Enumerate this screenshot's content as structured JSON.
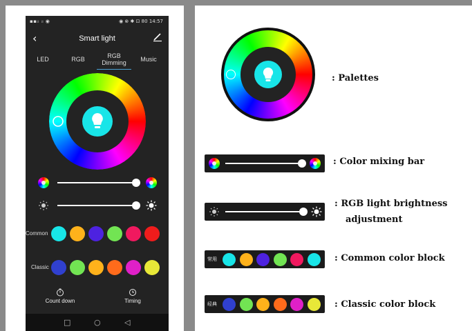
{
  "status_bar": {
    "left": "▪▪ᵢₗ ᵢₗ ◉",
    "right": "◉ ⊗ ✱ ⊡ 80 14:57"
  },
  "app": {
    "title": "Smart light"
  },
  "tabs": [
    {
      "label": "LED",
      "active": false
    },
    {
      "label": "RGB",
      "active": false
    },
    {
      "label": "RGB Dimming",
      "active": true
    },
    {
      "label": "Music",
      "active": false
    }
  ],
  "sliders": {
    "color_mixing": {
      "icon_left": "color-wheel-icon",
      "icon_right": "color-wheel-icon",
      "level": 0.95
    },
    "brightness": {
      "icon_left": "sun-dim-icon",
      "icon_right": "sun-bright-icon",
      "level": 0.95
    }
  },
  "color_blocks": {
    "common": {
      "label": "Common",
      "colors": [
        "#18e5e8",
        "#ffb21b",
        "#4d22e0",
        "#72e453",
        "#f0195f",
        "#f01c1c"
      ]
    },
    "classic": {
      "label": "Classic",
      "colors": [
        "#3040cf",
        "#72e453",
        "#ffb21b",
        "#ff6b1b",
        "#e020c8",
        "#e8e838"
      ]
    }
  },
  "actions": {
    "countdown": {
      "label": "Count down",
      "icon": "timer-icon"
    },
    "timing": {
      "label": "Timing",
      "icon": "clock-icon"
    }
  },
  "legend": {
    "palettes": ": Palettes",
    "color_mixing_bar": ": Color mixing bar",
    "rgb_brightness_line1": ": RGB light brightness",
    "rgb_brightness_line2": "adjustment",
    "common_block": ": Common color block",
    "common_block_label": "常用",
    "common_block_colors": [
      "#18e5e8",
      "#ffb21b",
      "#4d22e0",
      "#72e453",
      "#f0195f",
      "#18e5e8"
    ],
    "classic_block": ": Classic color block",
    "classic_block_label": "经典",
    "classic_block_colors": [
      "#3040cf",
      "#72e453",
      "#ffb21b",
      "#ff6b1b",
      "#e020c8",
      "#e8e838"
    ]
  },
  "colors": {
    "accent": "#4aa3d8",
    "bulb": "#18e5e8",
    "phone_bg": "#232323"
  }
}
